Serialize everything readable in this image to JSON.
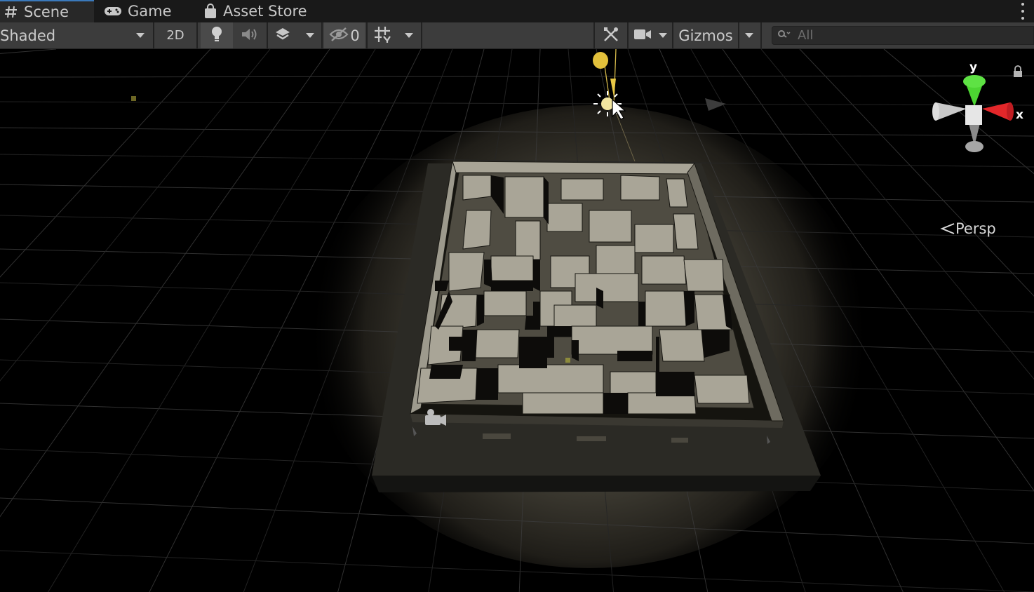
{
  "tabs": [
    {
      "label": "Scene",
      "icon": "hash-icon"
    },
    {
      "label": "Game",
      "icon": "gamepad-icon"
    },
    {
      "label": "Asset Store",
      "icon": "shopping-bag-icon"
    }
  ],
  "toolbar": {
    "shading_mode": "Shaded",
    "two_d_label": "2D",
    "hidden_count": "0",
    "gizmos_label": "Gizmos",
    "search_placeholder": "All"
  },
  "orientation_gizmo": {
    "y_label": "y",
    "x_label": "x",
    "projection_label": "Persp"
  },
  "colors": {
    "active_tab_accent": "#3a79bb",
    "axis_x": "#e3272a",
    "axis_y": "#4cd532",
    "light_gizmo": "#e8c845"
  }
}
